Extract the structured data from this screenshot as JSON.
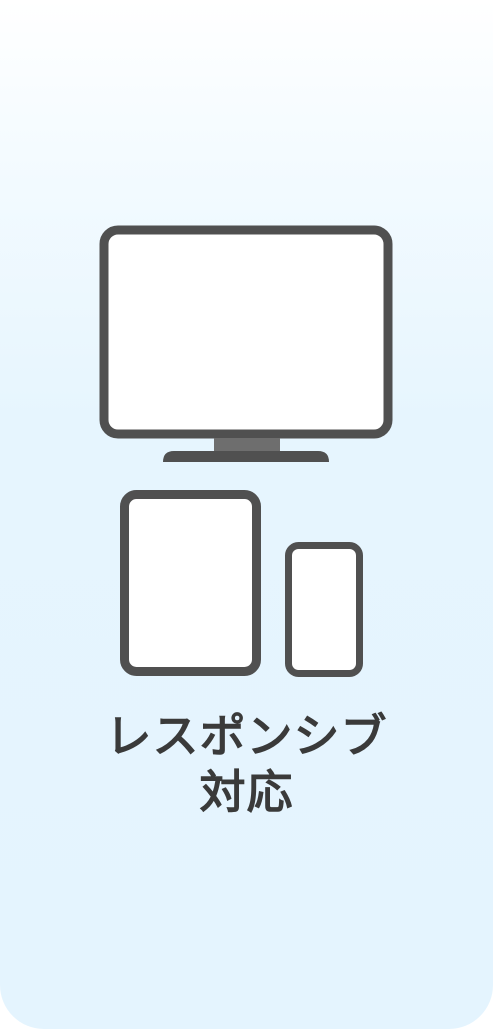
{
  "caption": {
    "line1": "レスポンシブ",
    "line2": "対応"
  },
  "icons": {
    "monitor": "monitor-icon",
    "tablet": "tablet-icon",
    "phone": "smartphone-icon"
  },
  "colors": {
    "device_frame": "#505050",
    "device_screen": "#ffffff",
    "background_top": "#ffffff",
    "background_bottom": "#e4f4fe",
    "text": "#3a3a3a"
  }
}
